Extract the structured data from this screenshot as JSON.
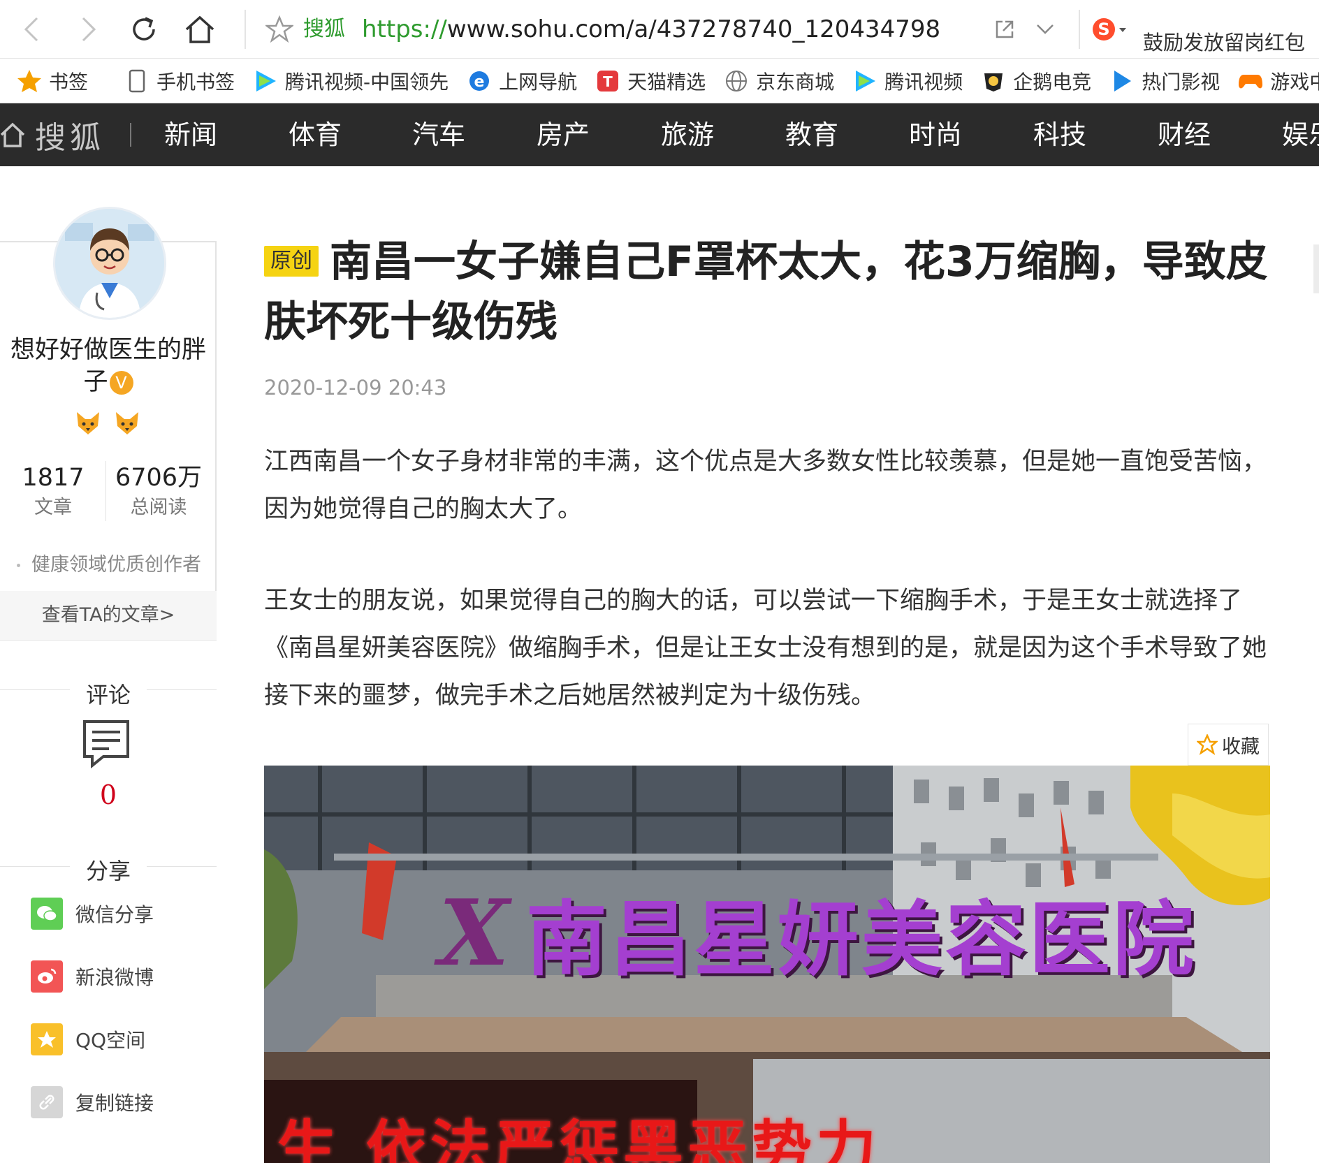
{
  "browser": {
    "site_name": "搜狐",
    "url_protocol": "https://",
    "url_rest": "www.sohu.com/a/437278740_120434798",
    "promo_text": "鼓励发放留岗红包"
  },
  "bookmarks": [
    {
      "label": "书签",
      "icon": "star-icon",
      "color": "#f5a000"
    },
    {
      "label": "手机书签",
      "icon": "phone-icon",
      "color": "#666666"
    },
    {
      "label": "腾讯视频-中国领先",
      "icon": "tencent-video-icon",
      "color": "#20b4ff"
    },
    {
      "label": "上网导航",
      "icon": "ie-icon",
      "color": "#1e7be0"
    },
    {
      "label": "天猫精选",
      "icon": "tmall-icon",
      "color": "#e4393c"
    },
    {
      "label": "京东商城",
      "icon": "globe-icon",
      "color": "#777777"
    },
    {
      "label": "腾讯视频",
      "icon": "tencent-video-icon",
      "color": "#20b4ff"
    },
    {
      "label": "企鹅电竞",
      "icon": "penguin-esports-icon",
      "color": "#222222"
    },
    {
      "label": "热门影视",
      "icon": "play-icon",
      "color": "#1e88e5"
    },
    {
      "label": "游戏中心",
      "icon": "gamepad-icon",
      "color": "#ff7a00"
    }
  ],
  "nav": {
    "logo": "搜狐",
    "items": [
      "新闻",
      "体育",
      "汽车",
      "房产",
      "旅游",
      "教育",
      "时尚",
      "科技",
      "财经",
      "娱乐"
    ]
  },
  "author": {
    "name": "想好好做医生的胖子",
    "verified_mark": "V",
    "articles_count": "1817",
    "articles_label": "文章",
    "reads_count": "6706万",
    "reads_label": "总阅读",
    "honor": "健康领域优质创作者",
    "view_link": "查看TA的文章>"
  },
  "comments": {
    "title": "评论",
    "count": "0"
  },
  "share": {
    "title": "分享",
    "items": [
      {
        "label": "微信分享",
        "icon": "wechat-icon",
        "color": "#5fce55"
      },
      {
        "label": "新浪微博",
        "icon": "weibo-icon",
        "color": "#f25555"
      },
      {
        "label": "QQ空间",
        "icon": "qzone-icon",
        "color": "#f9c02a"
      },
      {
        "label": "复制链接",
        "icon": "link-icon",
        "color": "#d6d6d6"
      }
    ]
  },
  "article": {
    "tag": "原创",
    "title": "南昌一女子嫌自己F罩杯太大，花3万缩胸，导致皮肤坏死十级伤残",
    "date": "2020-12-09 20:43",
    "paragraphs": [
      "江西南昌一个女子身材非常的丰满，这个优点是大多数女性比较羡慕，但是她一直饱受苦恼，因为她觉得自己的胸太大了。",
      "王女士的朋友说，如果觉得自己的胸大的话，可以尝试一下缩胸手术，于是王女士就选择了《南昌星妍美容医院》做缩胸手术，但是让王女士没有想到的是，就是因为这个手术导致了她接下来的噩梦，做完手术之后她居然被判定为十级伤残。"
    ],
    "favorite_label": "收藏",
    "image": {
      "sign_logo": "X",
      "sign_text": "南昌星妍美容医院",
      "led_text": "生 依法严惩黑恶势力"
    }
  }
}
